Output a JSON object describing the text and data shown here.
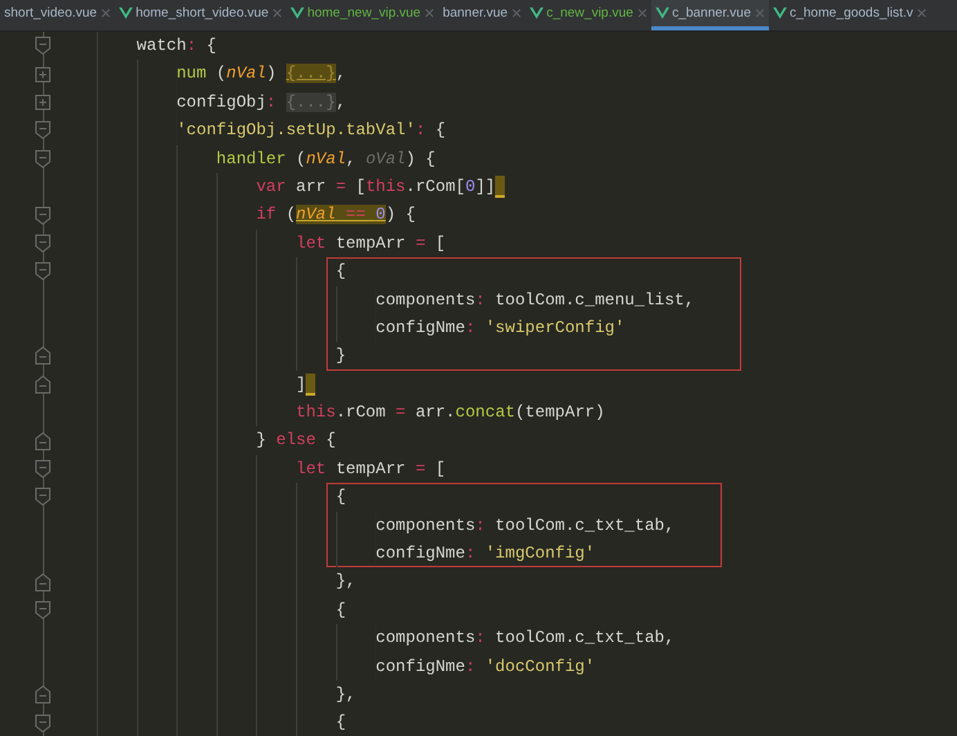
{
  "tabs": [
    {
      "label": "short_video.vue",
      "selected": false,
      "modified": false,
      "icon": false
    },
    {
      "label": "home_short_video.vue",
      "selected": false,
      "modified": false,
      "icon": true
    },
    {
      "label": "home_new_vip.vue",
      "selected": false,
      "modified": true,
      "icon": true
    },
    {
      "label": "banner.vue",
      "selected": false,
      "modified": false,
      "icon": false
    },
    {
      "label": "c_new_vip.vue",
      "selected": false,
      "modified": true,
      "icon": true
    },
    {
      "label": "c_banner.vue",
      "selected": true,
      "modified": false,
      "icon": true
    },
    {
      "label": "c_home_goods_list.v",
      "selected": false,
      "modified": false,
      "icon": true
    }
  ],
  "blocks": [
    {
      "kind": "plain",
      "lines": [
        {
          "kind": "open",
          "tokens": [
            {
              "kind": "plain",
              "text": "    watch"
            },
            {
              "kind": "op",
              "text": ":"
            },
            {
              "kind": "plain",
              "text": " {"
            }
          ]
        },
        {
          "kind": "plus",
          "tokens": [
            {
              "kind": "fn",
              "text": "        num"
            },
            {
              "kind": "plain",
              "text": " ("
            },
            {
              "kind": "param",
              "text": "nVal"
            },
            {
              "kind": "plain",
              "text": ") "
            },
            {
              "kind": "foldhl",
              "text": "{...}"
            },
            {
              "kind": "plain",
              "text": ","
            }
          ]
        },
        {
          "kind": "plus",
          "tokens": [
            {
              "kind": "plain",
              "text": "        configObj"
            },
            {
              "kind": "op",
              "text": ": "
            },
            {
              "kind": "fold",
              "text": "{...}"
            },
            {
              "kind": "plain",
              "text": ","
            }
          ]
        },
        {
          "kind": "open",
          "tokens": [
            {
              "kind": "str",
              "text": "        'configObj.setUp.tabVal'"
            },
            {
              "kind": "op",
              "text": ":"
            },
            {
              "kind": "plain",
              "text": " {"
            }
          ]
        },
        {
          "kind": "open",
          "tokens": [
            {
              "kind": "fn",
              "text": "            handler"
            },
            {
              "kind": "plain",
              "text": " ("
            },
            {
              "kind": "param",
              "text": "nVal"
            },
            {
              "kind": "plain",
              "text": ", "
            },
            {
              "kind": "dim",
              "text": "oVal"
            },
            {
              "kind": "plain",
              "text": ") {"
            }
          ]
        },
        {
          "kind": "none",
          "tokens": [
            {
              "kind": "kw",
              "text": "                var"
            },
            {
              "kind": "plain",
              "text": " arr "
            },
            {
              "kind": "op",
              "text": "="
            },
            {
              "kind": "plain",
              "text": " ["
            },
            {
              "kind": "kw",
              "text": "this"
            },
            {
              "kind": "plain",
              "text": ".rCom["
            },
            {
              "kind": "num",
              "text": "0"
            },
            {
              "kind": "plain",
              "text": "]]"
            },
            {
              "kind": "caret"
            }
          ]
        },
        {
          "kind": "open",
          "tokens": [
            {
              "kind": "kw",
              "text": "                if"
            },
            {
              "kind": "plain",
              "text": " ("
            },
            {
              "kind": "paramhl",
              "text": "nVal"
            },
            {
              "kind": "ophl",
              "text": " == "
            },
            {
              "kind": "numhl",
              "text": "0"
            },
            {
              "kind": "plain",
              "text": ") {"
            }
          ]
        },
        {
          "kind": "open",
          "tokens": [
            {
              "kind": "kw",
              "text": "                    let"
            },
            {
              "kind": "plain",
              "text": " tempArr "
            },
            {
              "kind": "op",
              "text": "="
            },
            {
              "kind": "plain",
              "text": " ["
            }
          ]
        }
      ]
    },
    {
      "kind": "boxed",
      "lines": [
        {
          "kind": "open",
          "tokens": [
            {
              "kind": "plain",
              "text": "                        {"
            }
          ]
        },
        {
          "kind": "none",
          "tokens": [
            {
              "kind": "plain",
              "text": "                            components"
            },
            {
              "kind": "op",
              "text": ":"
            },
            {
              "kind": "plain",
              "text": " toolCom.c_menu_list,"
            }
          ]
        },
        {
          "kind": "none",
          "tokens": [
            {
              "kind": "plain",
              "text": "                            configNme"
            },
            {
              "kind": "op",
              "text": ": "
            },
            {
              "kind": "str",
              "text": "'swiperConfig'"
            }
          ]
        },
        {
          "kind": "close",
          "tokens": [
            {
              "kind": "plain",
              "text": "                        }"
            }
          ]
        }
      ]
    },
    {
      "kind": "plain",
      "lines": [
        {
          "kind": "close",
          "tokens": [
            {
              "kind": "plain",
              "text": "                    ]"
            },
            {
              "kind": "caret"
            }
          ]
        },
        {
          "kind": "none",
          "tokens": [
            {
              "kind": "kw",
              "text": "                    this"
            },
            {
              "kind": "plain",
              "text": ".rCom "
            },
            {
              "kind": "op",
              "text": "="
            },
            {
              "kind": "plain",
              "text": " arr."
            },
            {
              "kind": "fn",
              "text": "concat"
            },
            {
              "kind": "plain",
              "text": "(tempArr)"
            }
          ]
        },
        {
          "kind": "close",
          "tokens": [
            {
              "kind": "plain",
              "text": "                } "
            },
            {
              "kind": "kw",
              "text": "else"
            },
            {
              "kind": "plain",
              "text": " {"
            }
          ]
        },
        {
          "kind": "open",
          "tokens": [
            {
              "kind": "kw",
              "text": "                    let"
            },
            {
              "kind": "plain",
              "text": " tempArr "
            },
            {
              "kind": "op",
              "text": "="
            },
            {
              "kind": "plain",
              "text": " ["
            }
          ]
        }
      ]
    },
    {
      "kind": "boxed",
      "lines": [
        {
          "kind": "open",
          "tokens": [
            {
              "kind": "plain",
              "text": "                        {"
            }
          ]
        },
        {
          "kind": "none",
          "tokens": [
            {
              "kind": "plain",
              "text": "                            components"
            },
            {
              "kind": "op",
              "text": ":"
            },
            {
              "kind": "plain",
              "text": " toolCom.c_txt_tab,"
            }
          ]
        },
        {
          "kind": "none",
          "tokens": [
            {
              "kind": "plain",
              "text": "                            configNme"
            },
            {
              "kind": "op",
              "text": ": "
            },
            {
              "kind": "str",
              "text": "'imgConfig'"
            }
          ]
        }
      ]
    },
    {
      "kind": "plain",
      "lines": [
        {
          "kind": "close",
          "tokens": [
            {
              "kind": "plain",
              "text": "                        },"
            }
          ]
        },
        {
          "kind": "open",
          "tokens": [
            {
              "kind": "plain",
              "text": "                        {"
            }
          ]
        },
        {
          "kind": "none",
          "tokens": [
            {
              "kind": "plain",
              "text": "                            components"
            },
            {
              "kind": "op",
              "text": ":"
            },
            {
              "kind": "plain",
              "text": " toolCom.c_txt_tab,"
            }
          ]
        },
        {
          "kind": "none",
          "tokens": [
            {
              "kind": "plain",
              "text": "                            configNme"
            },
            {
              "kind": "op",
              "text": ": "
            },
            {
              "kind": "str",
              "text": "'docConfig'"
            }
          ]
        },
        {
          "kind": "close",
          "tokens": [
            {
              "kind": "plain",
              "text": "                        },"
            }
          ]
        },
        {
          "kind": "open",
          "tokens": [
            {
              "kind": "plain",
              "text": "                        {"
            }
          ]
        }
      ]
    }
  ]
}
